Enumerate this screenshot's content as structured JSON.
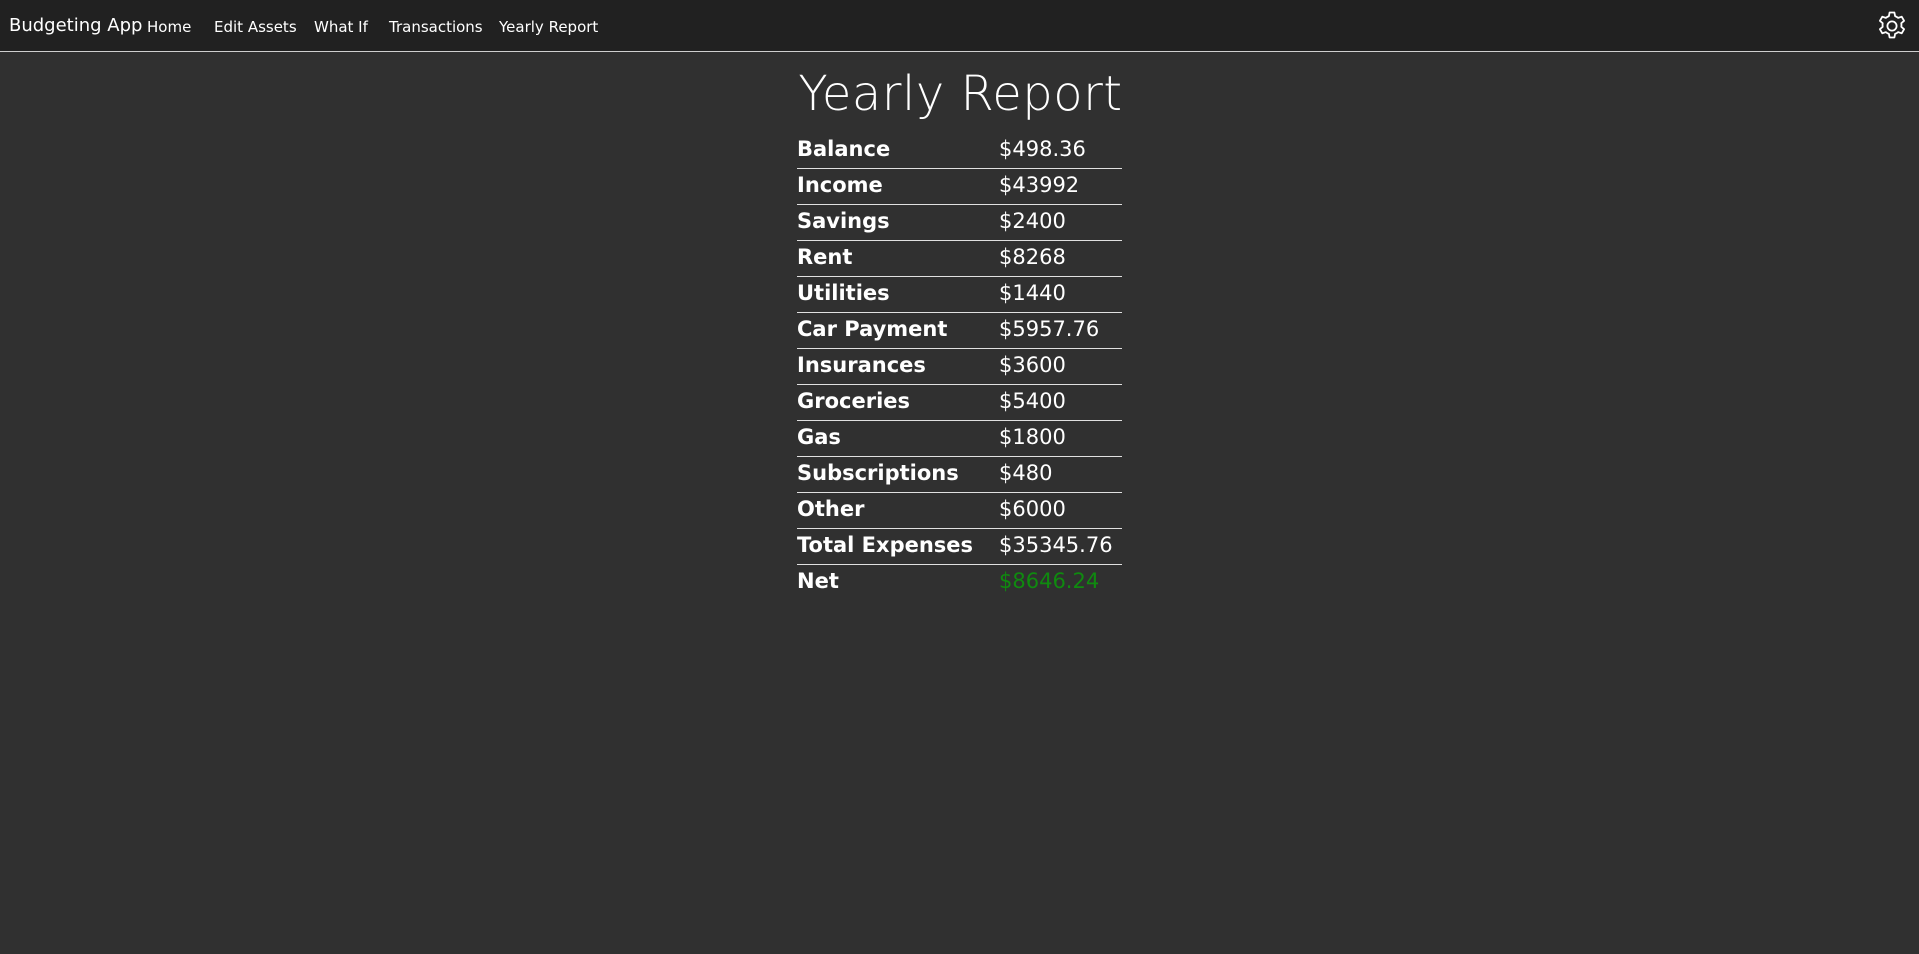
{
  "navbar": {
    "brand": "Budgeting App",
    "links": [
      {
        "label": "Home"
      },
      {
        "label": "Edit Assets"
      },
      {
        "label": "What If"
      },
      {
        "label": "Transactions"
      },
      {
        "label": "Yearly Report"
      }
    ],
    "settings_icon": "gear-icon"
  },
  "page": {
    "title": "Yearly Report"
  },
  "report": {
    "rows": [
      {
        "label": "Balance",
        "value": "$498.36"
      },
      {
        "label": "Income",
        "value": "$43992"
      },
      {
        "label": "Savings",
        "value": "$2400"
      },
      {
        "label": "Rent",
        "value": "$8268"
      },
      {
        "label": "Utilities",
        "value": "$1440"
      },
      {
        "label": "Car Payment",
        "value": "$5957.76"
      },
      {
        "label": "Insurances",
        "value": "$3600"
      },
      {
        "label": "Groceries",
        "value": "$5400"
      },
      {
        "label": "Gas",
        "value": "$1800"
      },
      {
        "label": "Subscriptions",
        "value": "$480"
      },
      {
        "label": "Other",
        "value": "$6000"
      },
      {
        "label": "Total Expenses",
        "value": "$35345.76"
      },
      {
        "label": "Net",
        "value": "$8646.24"
      }
    ]
  },
  "colors": {
    "background": "#303030",
    "navbar": "#212121",
    "positive": "#0f8a0f"
  }
}
